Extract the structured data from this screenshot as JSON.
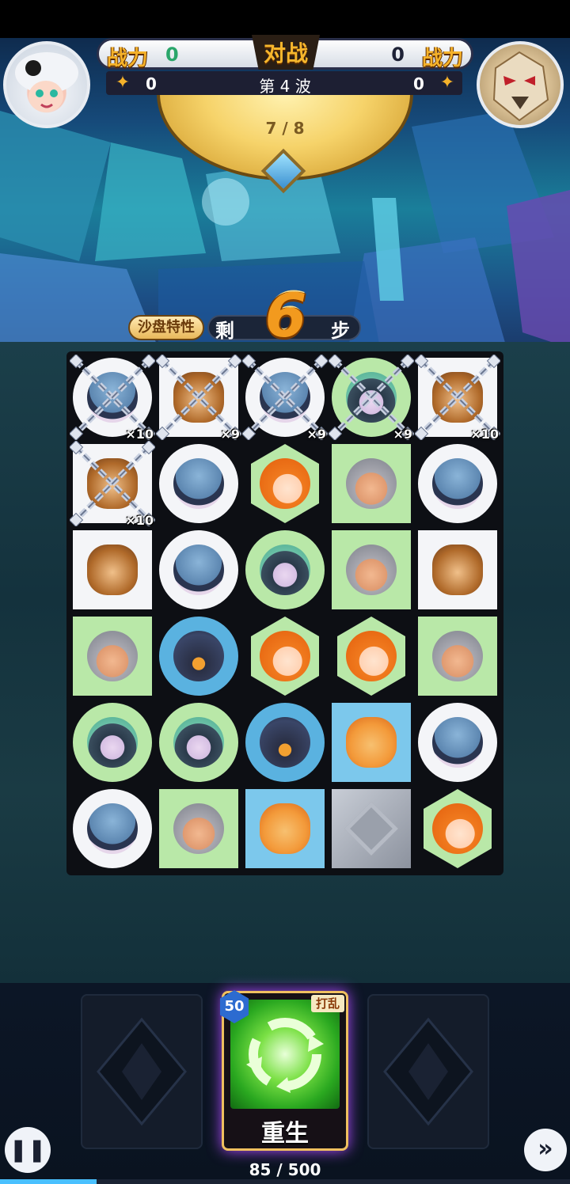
{
  "header": {
    "vs_label": "对战",
    "left_power_label": "战力",
    "left_power_value": "0",
    "right_power_label": "战力",
    "right_power_value": "0",
    "left_stars": "0",
    "right_stars": "0",
    "wave_label": "第 4 波",
    "shield_progress": "7 / 8"
  },
  "moves": {
    "feature_label": "沙盘特性",
    "prefix": "剩",
    "count": "6",
    "suffix": "步"
  },
  "board": {
    "rows": [
      [
        {
          "shape": "circle-white",
          "face": "ninja",
          "chained": true,
          "count": "×10"
        },
        {
          "shape": "square-white",
          "face": "bear",
          "chained": true,
          "count": "×9"
        },
        {
          "shape": "circle-white",
          "face": "ninja",
          "chained": true,
          "count": "×9"
        },
        {
          "shape": "circle-green",
          "face": "hood",
          "chained": true,
          "count": "×9"
        },
        {
          "shape": "square-white",
          "face": "bear",
          "chained": true,
          "count": "×10"
        }
      ],
      [
        {
          "shape": "square-white",
          "face": "bear",
          "chained": true,
          "count": "×10"
        },
        {
          "shape": "circle-white",
          "face": "ninja"
        },
        {
          "shape": "hex-green",
          "face": "orange"
        },
        {
          "shape": "square-green",
          "face": "grey"
        },
        {
          "shape": "circle-white",
          "face": "ninja"
        }
      ],
      [
        {
          "shape": "square-white",
          "face": "bear"
        },
        {
          "shape": "circle-white",
          "face": "ninja"
        },
        {
          "shape": "circle-green",
          "face": "hood"
        },
        {
          "shape": "square-green",
          "face": "grey"
        },
        {
          "shape": "square-white",
          "face": "bear"
        }
      ],
      [
        {
          "shape": "square-green",
          "face": "grey"
        },
        {
          "shape": "circle-blue",
          "face": "darkhood"
        },
        {
          "shape": "hex-green",
          "face": "orange"
        },
        {
          "shape": "hex-green",
          "face": "orange"
        },
        {
          "shape": "square-green",
          "face": "grey"
        }
      ],
      [
        {
          "shape": "circle-green",
          "face": "hood"
        },
        {
          "shape": "circle-green",
          "face": "hood"
        },
        {
          "shape": "circle-blue",
          "face": "darkhood"
        },
        {
          "shape": "square-blue",
          "face": "monk"
        },
        {
          "shape": "circle-white",
          "face": "ninja"
        }
      ],
      [
        {
          "shape": "circle-white",
          "face": "ninja"
        },
        {
          "shape": "square-green",
          "face": "grey"
        },
        {
          "shape": "square-blue",
          "face": "monk"
        },
        {
          "shape": "stone",
          "face": "stone"
        },
        {
          "shape": "hex-green",
          "face": "orange"
        }
      ]
    ]
  },
  "card": {
    "cost": "50",
    "tag": "打乱",
    "name": "重生"
  },
  "energy": {
    "text": "85 / 500",
    "fraction": 0.17
  },
  "controls": {
    "pause_icon": "pause-icon",
    "fast_forward_icon": "fast-forward-icon"
  },
  "colors": {
    "power_gold": "#f5b22a",
    "left_power_value_color": "#2aa66a",
    "steps_orange": "#f29a1e"
  }
}
